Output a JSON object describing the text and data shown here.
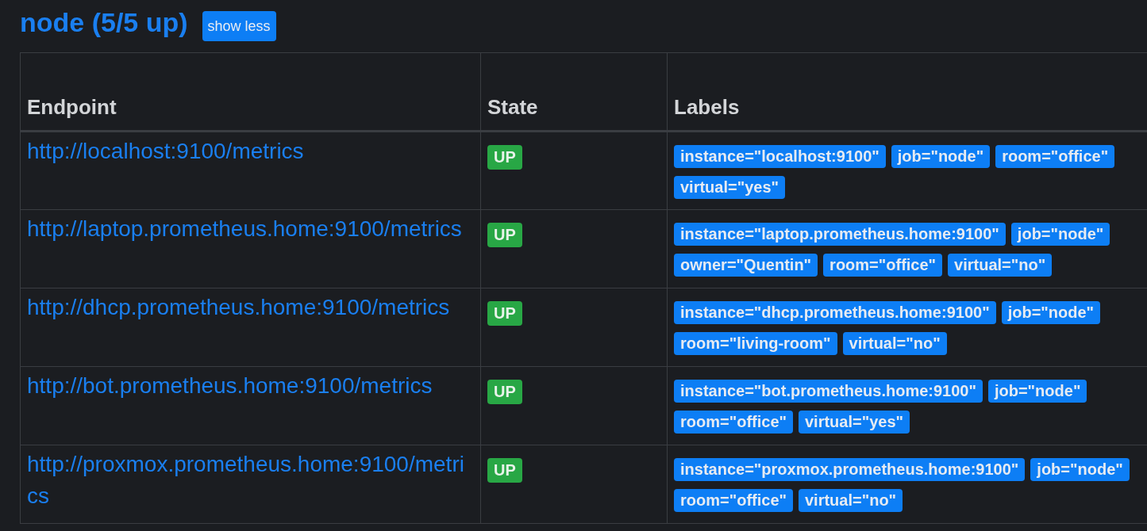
{
  "title": "node (5/5 up)",
  "toggle_button": "show less",
  "table": {
    "columns": [
      "Endpoint",
      "State",
      "Labels"
    ],
    "rows": [
      {
        "endpoint": "http://localhost:9100/metrics",
        "state": {
          "text": "UP",
          "kind": "up"
        },
        "labels": [
          "instance=\"localhost:9100\"",
          "job=\"node\"",
          "room=\"office\"",
          "virtual=\"yes\""
        ]
      },
      {
        "endpoint": "http://laptop.prometheus.home:9100/metrics",
        "state": {
          "text": "UP",
          "kind": "up"
        },
        "labels": [
          "instance=\"laptop.prometheus.home:9100\"",
          "job=\"node\"",
          "owner=\"Quentin\"",
          "room=\"office\"",
          "virtual=\"no\""
        ]
      },
      {
        "endpoint": "http://dhcp.prometheus.home:9100/metrics",
        "state": {
          "text": "UP",
          "kind": "up"
        },
        "labels": [
          "instance=\"dhcp.prometheus.home:9100\"",
          "job=\"node\"",
          "room=\"living-room\"",
          "virtual=\"no\""
        ]
      },
      {
        "endpoint": "http://bot.prometheus.home:9100/metrics",
        "state": {
          "text": "UP",
          "kind": "up"
        },
        "labels": [
          "instance=\"bot.prometheus.home:9100\"",
          "job=\"node\"",
          "room=\"office\"",
          "virtual=\"yes\""
        ]
      },
      {
        "endpoint": "http://proxmox.prometheus.home:9100/metrics",
        "state": {
          "text": "UP",
          "kind": "up"
        },
        "labels": [
          "instance=\"proxmox.prometheus.home:9100\"",
          "job=\"node\"",
          "room=\"office\"",
          "virtual=\"no\""
        ]
      }
    ]
  }
}
